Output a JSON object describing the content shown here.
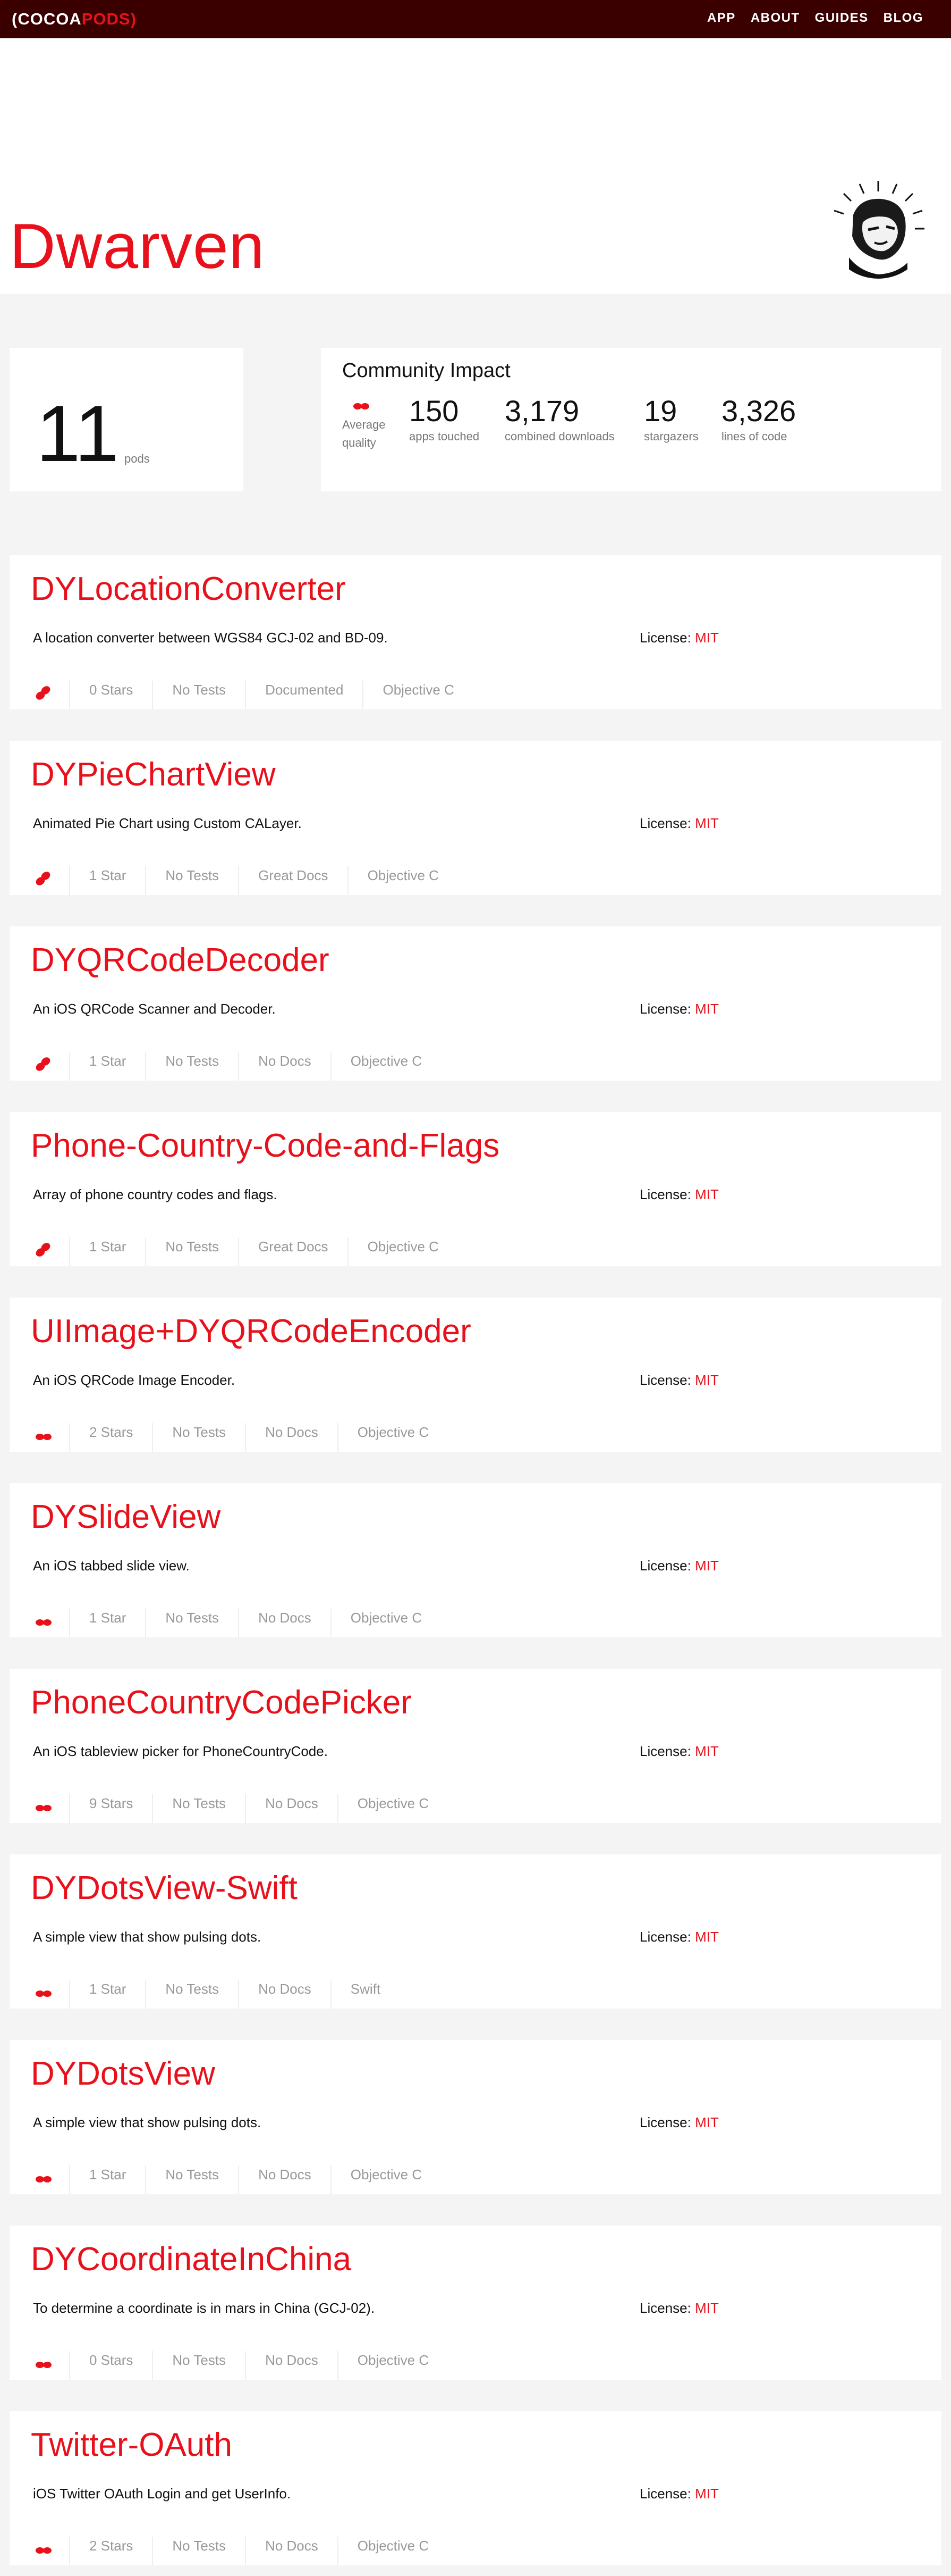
{
  "nav": {
    "logo_left": "(COCOA",
    "logo_right": "PODS)",
    "items": [
      {
        "label": "APP"
      },
      {
        "label": "ABOUT"
      },
      {
        "label": "GUIDES"
      },
      {
        "label": "BLOG"
      }
    ]
  },
  "owner": {
    "name": "Dwarven"
  },
  "stats": {
    "pods_count": "11",
    "pods_label": "pods",
    "impact_title": "Community Impact",
    "quality_label": "Average quality",
    "items": [
      {
        "value": "150",
        "label": "apps touched"
      },
      {
        "value": "3,179",
        "label": "combined downloads"
      },
      {
        "value": "19",
        "label": "stargazers"
      },
      {
        "value": "3,326",
        "label": "lines of code"
      }
    ]
  },
  "pods": [
    {
      "name": "DYLocationConverter",
      "description": "A location converter between WGS84 GCJ-02 and BD-09.",
      "license_label": "License:",
      "license": "MIT",
      "quality_icon": "quality-high-icon",
      "stars": "0 Stars",
      "tests": "No Tests",
      "docs": "Documented",
      "language": "Objective C"
    },
    {
      "name": "DYPieChartView",
      "description": "Animated Pie Chart using Custom CALayer.",
      "license_label": "License:",
      "license": "MIT",
      "quality_icon": "quality-high-icon",
      "stars": "1 Star",
      "tests": "No Tests",
      "docs": "Great Docs",
      "language": "Objective C"
    },
    {
      "name": "DYQRCodeDecoder",
      "description": "An iOS QRCode Scanner and Decoder.",
      "license_label": "License:",
      "license": "MIT",
      "quality_icon": "quality-high-icon",
      "stars": "1 Star",
      "tests": "No Tests",
      "docs": "No Docs",
      "language": "Objective C"
    },
    {
      "name": "Phone-Country-Code-and-Flags",
      "description": "Array of phone country codes and flags.",
      "license_label": "License:",
      "license": "MIT",
      "quality_icon": "quality-high-icon",
      "stars": "1 Star",
      "tests": "No Tests",
      "docs": "Great Docs",
      "language": "Objective C"
    },
    {
      "name": "UIImage+DYQRCodeEncoder",
      "description": "An iOS QRCode Image Encoder.",
      "license_label": "License:",
      "license": "MIT",
      "quality_icon": "quality-medium-icon",
      "stars": "2 Stars",
      "tests": "No Tests",
      "docs": "No Docs",
      "language": "Objective C"
    },
    {
      "name": "DYSlideView",
      "description": "An iOS tabbed slide view.",
      "license_label": "License:",
      "license": "MIT",
      "quality_icon": "quality-medium-icon",
      "stars": "1 Star",
      "tests": "No Tests",
      "docs": "No Docs",
      "language": "Objective C"
    },
    {
      "name": "PhoneCountryCodePicker",
      "description": "An iOS tableview picker for PhoneCountryCode.",
      "license_label": "License:",
      "license": "MIT",
      "quality_icon": "quality-medium-icon",
      "stars": "9 Stars",
      "tests": "No Tests",
      "docs": "No Docs",
      "language": "Objective C"
    },
    {
      "name": "DYDotsView-Swift",
      "description": "A simple view that show pulsing dots.",
      "license_label": "License:",
      "license": "MIT",
      "quality_icon": "quality-medium-icon",
      "stars": "1 Star",
      "tests": "No Tests",
      "docs": "No Docs",
      "language": "Swift"
    },
    {
      "name": "DYDotsView",
      "description": "A simple view that show pulsing dots.",
      "license_label": "License:",
      "license": "MIT",
      "quality_icon": "quality-medium-icon",
      "stars": "1 Star",
      "tests": "No Tests",
      "docs": "No Docs",
      "language": "Objective C"
    },
    {
      "name": "DYCoordinateInChina",
      "description": "To determine a coordinate is in mars in China (GCJ-02).",
      "license_label": "License:",
      "license": "MIT",
      "quality_icon": "quality-medium-icon",
      "stars": "0 Stars",
      "tests": "No Tests",
      "docs": "No Docs",
      "language": "Objective C"
    },
    {
      "name": "Twitter-OAuth",
      "description": "iOS Twitter OAuth Login and get UserInfo.",
      "license_label": "License:",
      "license": "MIT",
      "quality_icon": "quality-medium-icon",
      "stars": "2 Stars",
      "tests": "No Tests",
      "docs": "No Docs",
      "language": "Objective C"
    }
  ],
  "colors": {
    "brand_red": "#e8111b",
    "nav_bg": "#3a0000",
    "page_bg": "#f4f4f4"
  }
}
